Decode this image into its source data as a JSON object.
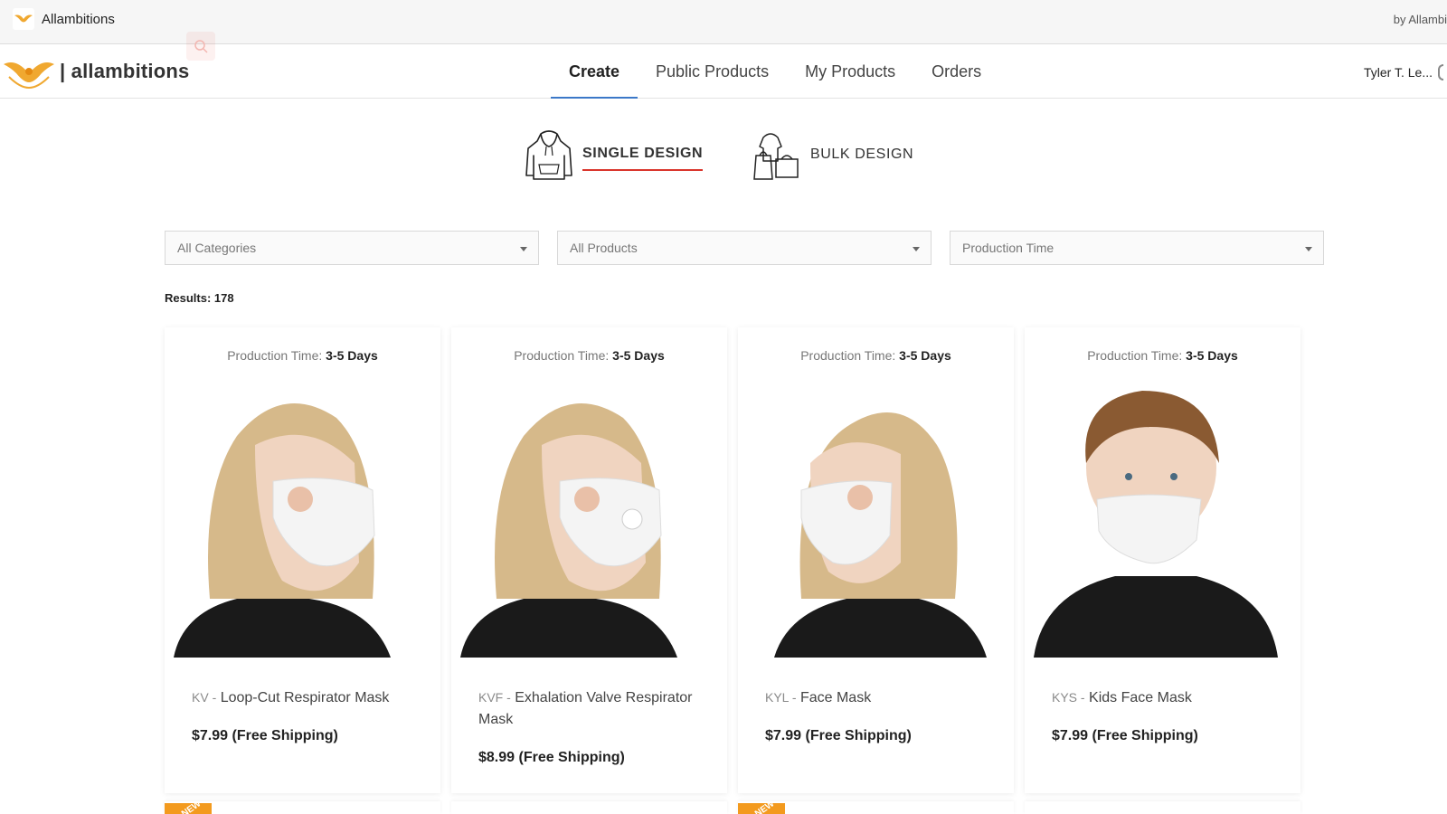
{
  "window": {
    "title": "Allambitions",
    "byline": "by Allambi"
  },
  "brand": {
    "wordmark": "| allambitions",
    "accent": "#f0a830"
  },
  "nav": {
    "tabs": [
      {
        "label": "Create",
        "active": true
      },
      {
        "label": "Public Products",
        "active": false
      },
      {
        "label": "My Products",
        "active": false
      },
      {
        "label": "Orders",
        "active": false
      }
    ],
    "user_name": "Tyler T. Le..."
  },
  "design_modes": {
    "single": {
      "label": "SINGLE DESIGN",
      "active": true
    },
    "bulk": {
      "label": "BULK DESIGN",
      "active": false
    }
  },
  "filters": {
    "categories": {
      "value": "All Categories"
    },
    "products": {
      "value": "All Products"
    },
    "production_time": {
      "value": "Production Time"
    }
  },
  "results": {
    "label": "Results: 178"
  },
  "products": [
    {
      "production_label": "Production Time:",
      "production_value": "3-5 Days",
      "code": "KV -",
      "name": "Loop-Cut Respirator Mask",
      "price": "$7.99 (Free Shipping)"
    },
    {
      "production_label": "Production Time:",
      "production_value": "3-5 Days",
      "code": "KVF -",
      "name": "Exhalation Valve Respirator Mask",
      "price": "$8.99 (Free Shipping)"
    },
    {
      "production_label": "Production Time:",
      "production_value": "3-5 Days",
      "code": "KYL -",
      "name": "Face Mask",
      "price": "$7.99 (Free Shipping)"
    },
    {
      "production_label": "Production Time:",
      "production_value": "3-5 Days",
      "code": "KYS -",
      "name": "Kids Face Mask",
      "price": "$7.99 (Free Shipping)"
    }
  ],
  "badges": {
    "new": "NEW"
  },
  "colors": {
    "active_tab_underline": "#3b78c8",
    "single_design_underline": "#d9342b",
    "new_badge": "#f39a1e"
  }
}
